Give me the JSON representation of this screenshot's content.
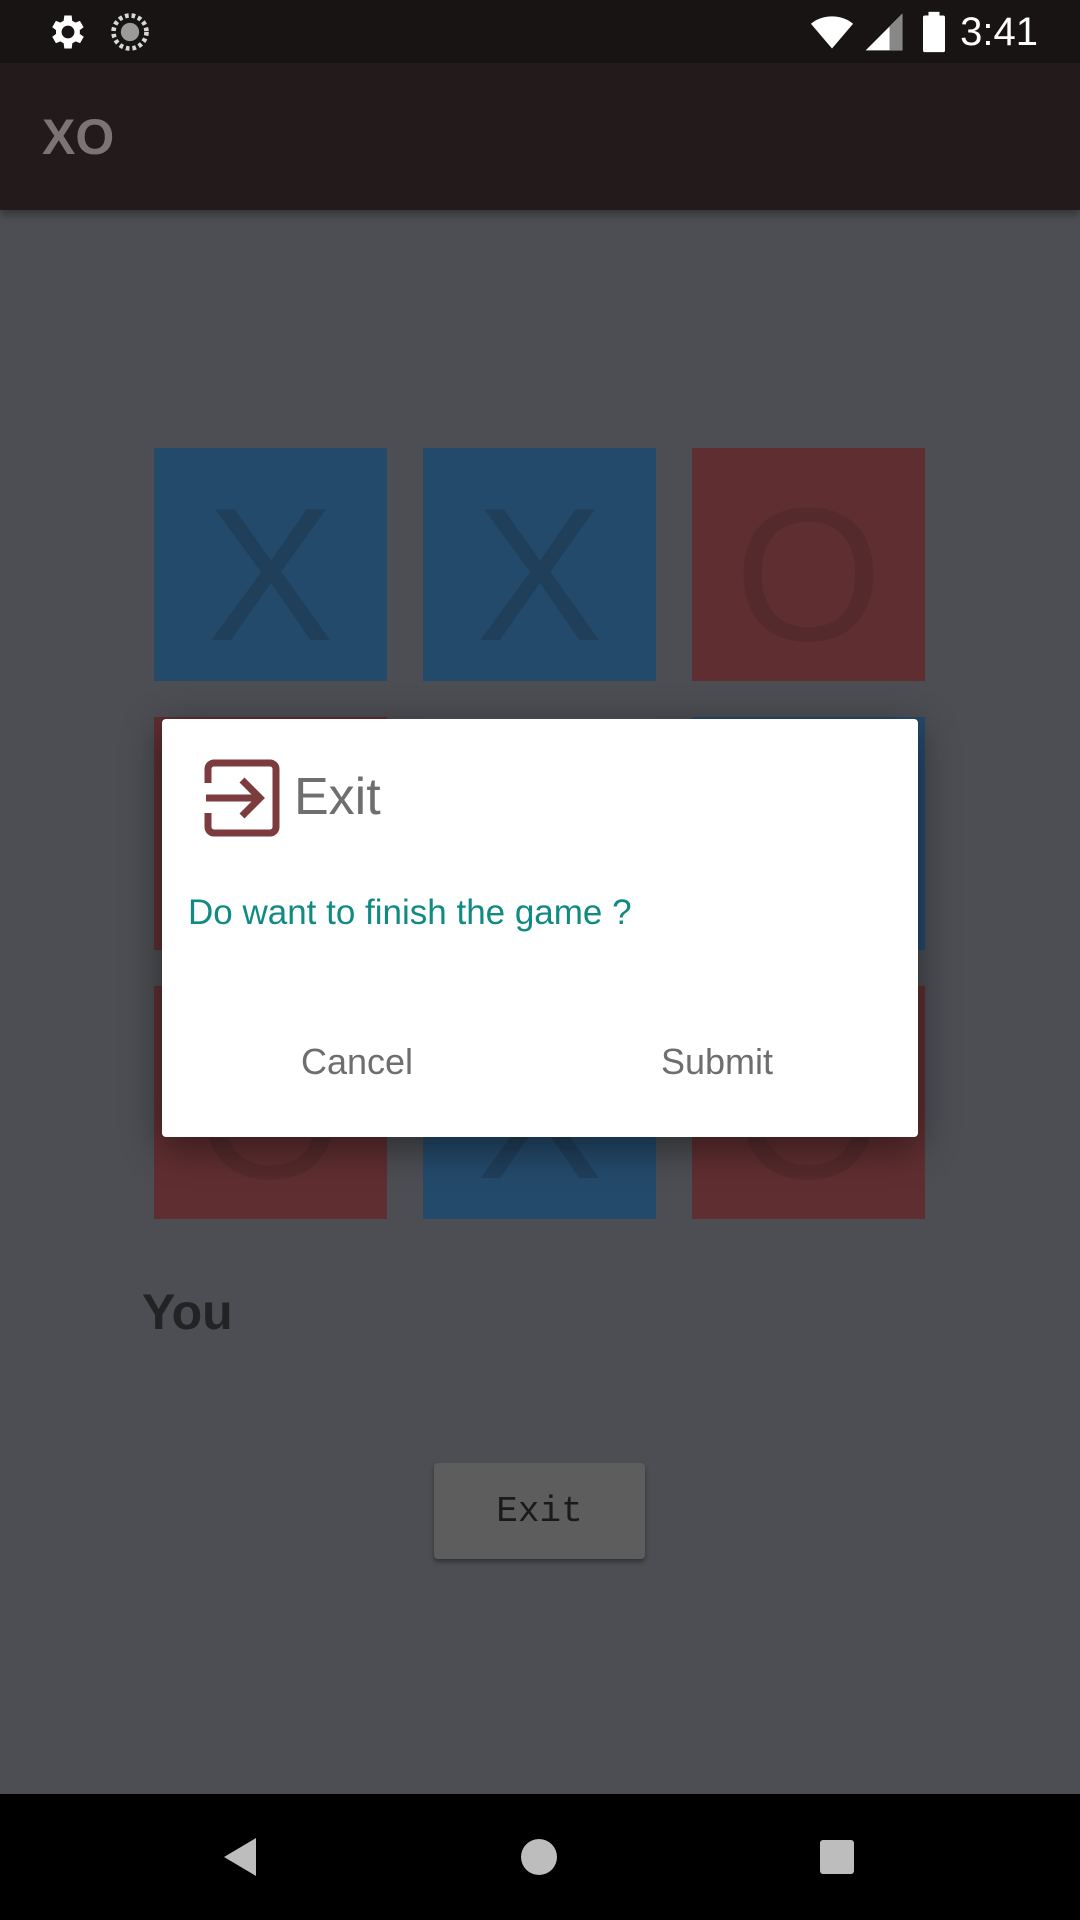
{
  "status_bar": {
    "time": "3:41",
    "icons": [
      "settings-icon",
      "sync-icon",
      "wifi-icon",
      "signal-icon",
      "battery-icon"
    ]
  },
  "app_bar": {
    "title": "XO"
  },
  "board": {
    "cells": [
      "X",
      "X",
      "O",
      "O",
      "",
      "",
      "O",
      "X",
      "O"
    ],
    "colors": {
      "x_cell": "#244a6b",
      "o_cell": "#5f2e30"
    }
  },
  "turn_label": "You",
  "exit_button_label": "Exit",
  "dialog": {
    "icon": "exit-icon",
    "title": "Exit",
    "message": "Do want to finish the game ?",
    "cancel_label": "Cancel",
    "submit_label": "Submit",
    "colors": {
      "message": "#128a84",
      "icon": "#7c3b3d"
    }
  },
  "nav_bar": {
    "icons": [
      "back-icon",
      "home-icon",
      "recents-icon"
    ]
  }
}
